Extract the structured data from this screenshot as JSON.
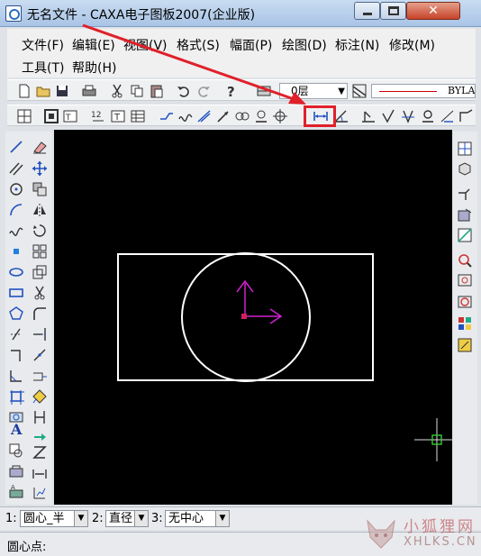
{
  "window": {
    "title": "无名文件 - CAXA电子图板2007(企业版)",
    "close_glyph": "✕"
  },
  "menu": {
    "items": [
      "文件(F)",
      "编辑(E)",
      "视图(V)",
      "格式(S)",
      "幅面(P)",
      "绘图(D)",
      "标注(N)",
      "修改(M)",
      "工具(T)",
      "帮助(H)"
    ]
  },
  "toolbar": {
    "layer": "0层",
    "linetype": "BYLAY"
  },
  "command_bar": {
    "num1": "1:",
    "opt1": "圆心_半",
    "num2": "2:",
    "opt2": "直径",
    "num3": "3:",
    "opt3": "无中心",
    "dropdown_glyph": "▼"
  },
  "status": {
    "prompt": "圆心点:"
  },
  "watermark": {
    "text_cn": "小狐狸网",
    "text_en": "XHLKS.CN"
  },
  "colors": {
    "canvas_bg": "#000000",
    "geometry": "#ffffff",
    "ucs_axis": "#d020d0",
    "cursor": "#33cc33",
    "annotation": "#e0202a"
  },
  "icons": {
    "highlighted_tool": "linear-dimension-icon"
  }
}
